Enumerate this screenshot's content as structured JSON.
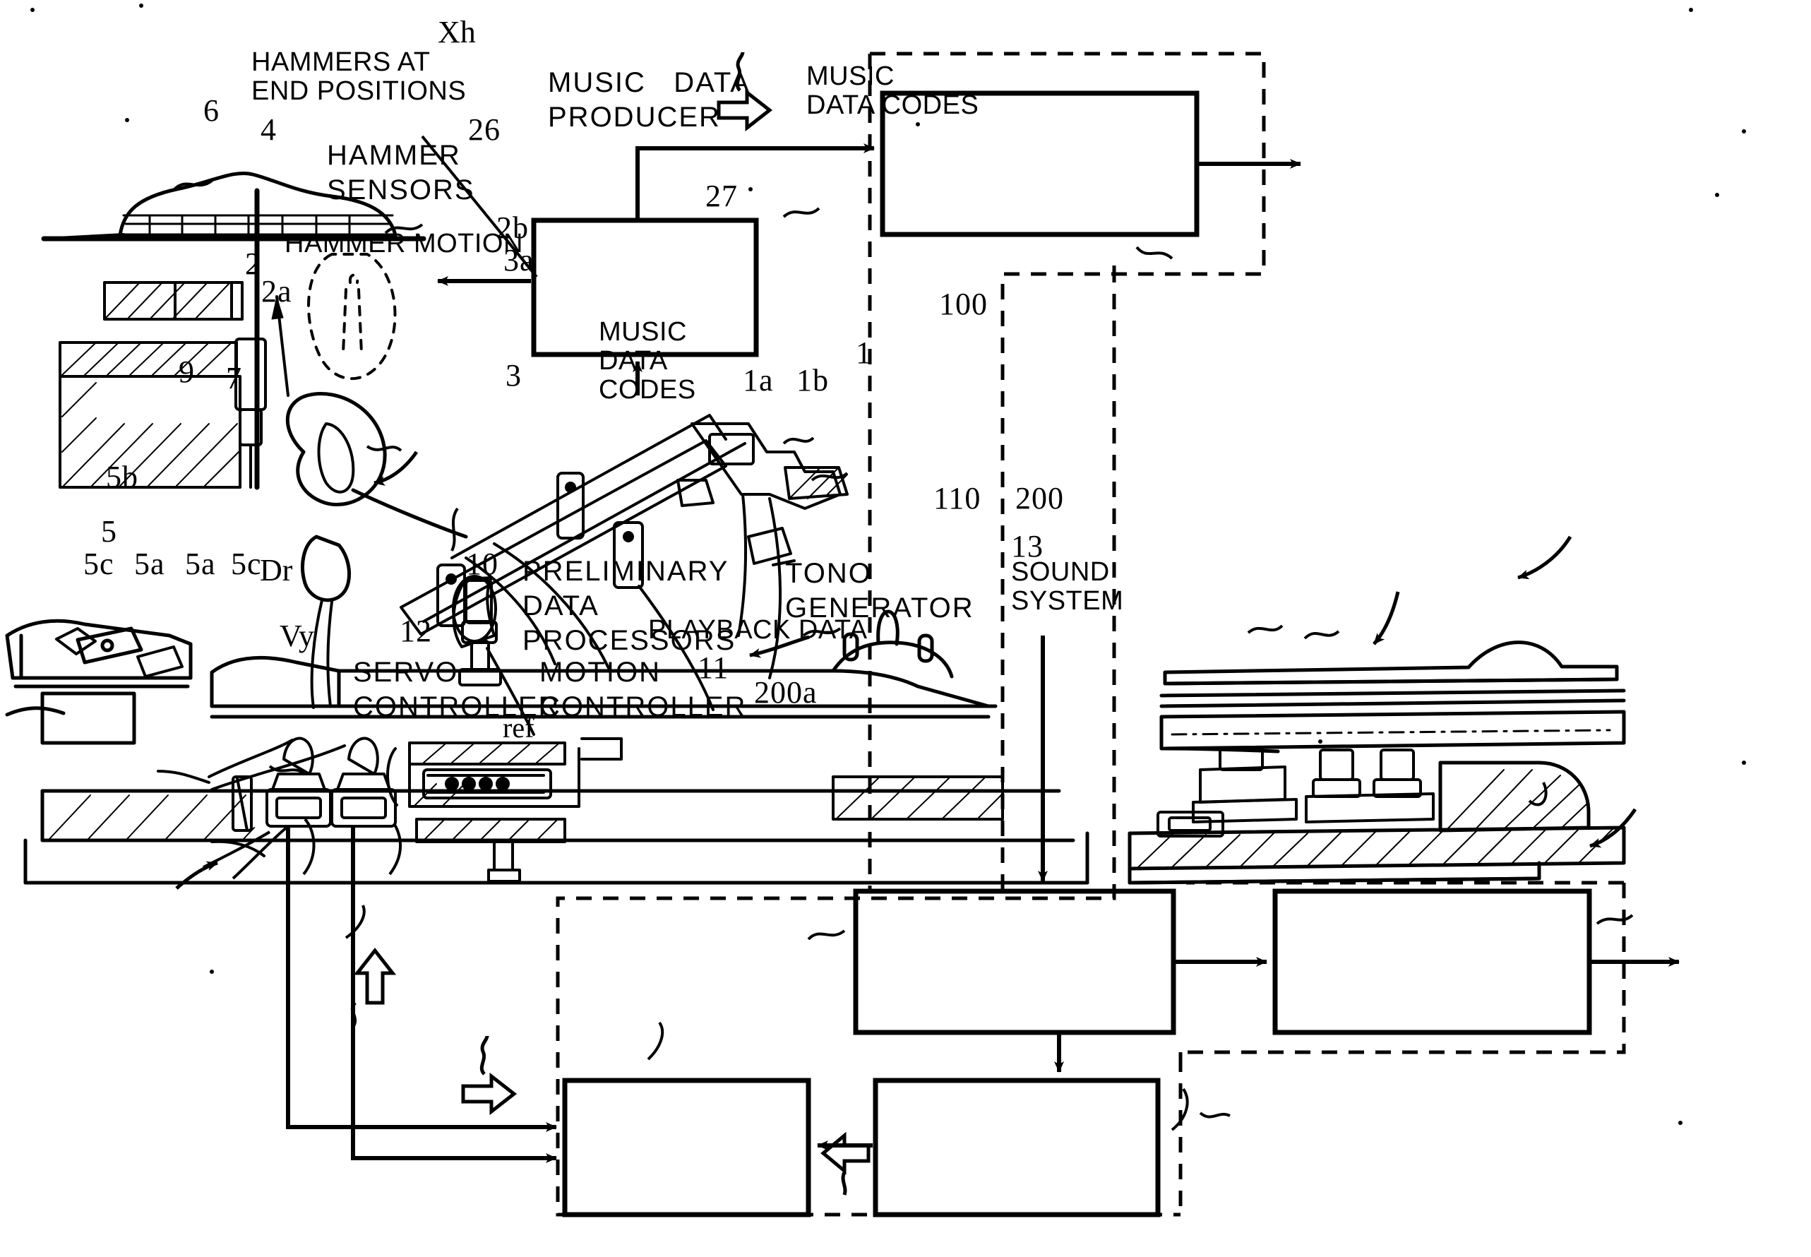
{
  "figure": {
    "kind": "patent-figure",
    "title": "Automatic player piano block diagram with acoustic piano action"
  },
  "blocks": {
    "hammer_sensors": {
      "label": "HAMMER\nSENSORS",
      "ref": "26"
    },
    "music_data_producer": {
      "label": "MUSIC   DATA\nPRODUCER",
      "ref": "27"
    },
    "preliminary_data_processors": {
      "label": "PRELIMINARY\nDATA\nPROCESSORS",
      "ref": "10"
    },
    "tono_generator": {
      "label": "TONO\nGENERATOR",
      "ref": "13"
    },
    "motion_controller": {
      "label": "MOTION\nCONTROLLER",
      "ref": "11"
    },
    "servo_controller": {
      "label": "SERVO\nCONTROLLER",
      "ref": "12"
    }
  },
  "signal_labels": {
    "hammers_at_end_positions": "HAMMERS AT\nEND POSITIONS",
    "hammer_motion": "HAMMER MOTION",
    "music_data_codes_out": "MUSIC\nDATA CODES",
    "music_data_codes_bus": "MUSIC\nDATA\nCODES",
    "playback_data": "PLAYBACK DATA",
    "sound_system": "SOUND\nSYSTEM",
    "xh": "Xh",
    "vy": "Vy",
    "dr": "Dr",
    "ref": "ref"
  },
  "reference_numerals": {
    "n1": "1",
    "n1a": "1a",
    "n1b": "1b",
    "n2": "2",
    "n2a": "2a",
    "n2b": "2b",
    "n3": "3",
    "n3a": "3a",
    "n4": "4",
    "n5": "5",
    "n5a_left": "5a",
    "n5a_right": "5a",
    "n5b": "5b",
    "n5c_left": "5c",
    "n5c_right": "5c",
    "n6": "6",
    "n7": "7",
    "n9": "9",
    "n10": "10",
    "n11": "11",
    "n12": "12",
    "n13": "13",
    "n26": "26",
    "n27": "27",
    "n100": "100",
    "n110": "110",
    "n200": "200",
    "n200a": "200a"
  },
  "colors": {
    "ink": "#000000",
    "paper": "#ffffff"
  }
}
